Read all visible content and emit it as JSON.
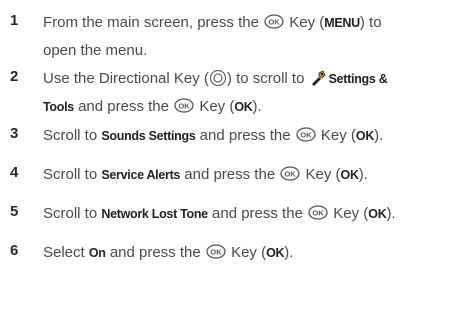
{
  "steps": [
    {
      "number": "1",
      "line1": {
        "a": "From the main screen, press the",
        "b": "Key (",
        "c": "MENU",
        "d": ") to"
      },
      "line2": "open the menu."
    },
    {
      "number": "2",
      "line1": {
        "a": "Use the Directional Key (",
        "b": ") to scroll to",
        "c": "Settings &"
      },
      "line2": {
        "a": "Tools",
        "b": "and press the",
        "c": "Key (",
        "d": "OK",
        "e": ")."
      }
    },
    {
      "number": "3",
      "parts": {
        "a": "Scroll to",
        "b": "Sounds Settings",
        "c": "and press the",
        "d": "Key (",
        "e": "OK",
        "f": ")."
      }
    },
    {
      "number": "4",
      "parts": {
        "a": "Scroll to",
        "b": "Service Alerts",
        "c": "and press the",
        "d": "Key (",
        "e": "OK",
        "f": ")."
      }
    },
    {
      "number": "5",
      "parts": {
        "a": "Scroll to",
        "b": "Network Lost Tone",
        "c": "and press the",
        "d": "Key (",
        "e": "OK",
        "f": ")."
      }
    },
    {
      "number": "6",
      "parts": {
        "a": "Select",
        "b": "On",
        "c": "and press the",
        "d": "Key (",
        "e": "OK",
        "f": ")."
      }
    }
  ],
  "icons": {
    "ok_key": "ok-key-icon",
    "directional_key": "directional-key-icon",
    "settings_tools": "settings-tools-icon"
  },
  "ok_icon_label": "OK"
}
